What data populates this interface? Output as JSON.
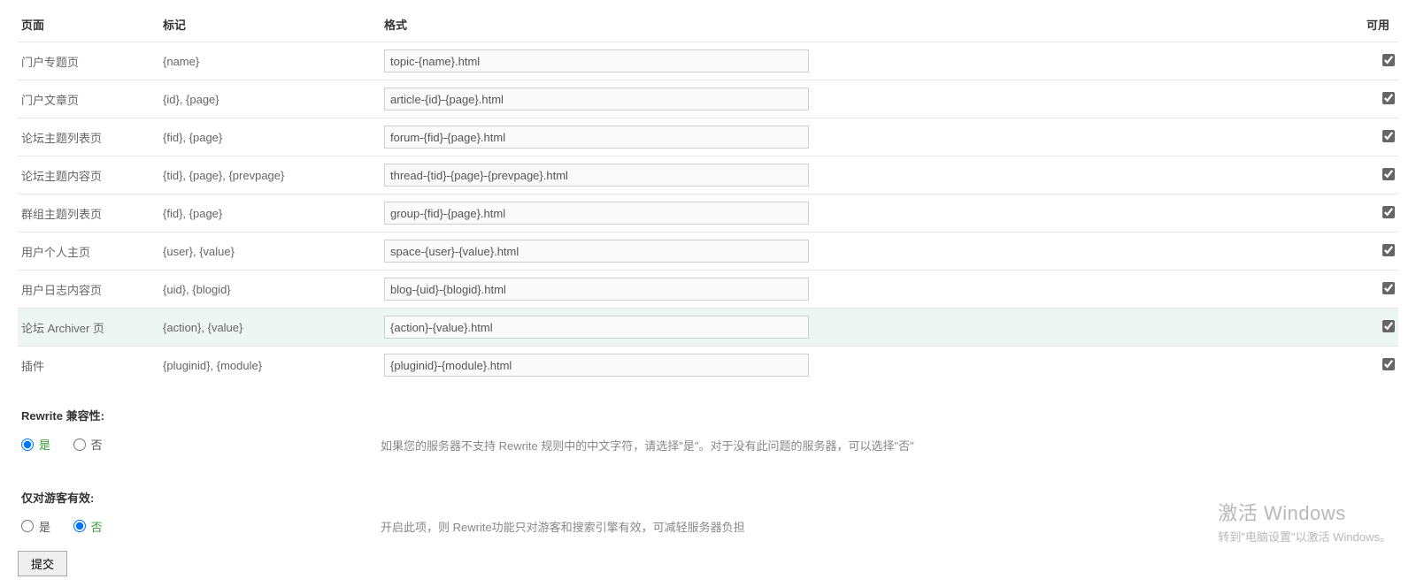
{
  "headers": {
    "page": "页面",
    "marker": "标记",
    "format": "格式",
    "avail": "可用"
  },
  "rows": [
    {
      "page": "门户专题页",
      "marker": "{name}",
      "format": "topic-{name}.html",
      "checked": true
    },
    {
      "page": "门户文章页",
      "marker": "{id}, {page}",
      "format": "article-{id}-{page}.html",
      "checked": true
    },
    {
      "page": "论坛主题列表页",
      "marker": "{fid}, {page}",
      "format": "forum-{fid}-{page}.html",
      "checked": true
    },
    {
      "page": "论坛主题内容页",
      "marker": "{tid}, {page}, {prevpage}",
      "format": "thread-{tid}-{page}-{prevpage}.html",
      "checked": true
    },
    {
      "page": "群组主题列表页",
      "marker": "{fid}, {page}",
      "format": "group-{fid}-{page}.html",
      "checked": true
    },
    {
      "page": "用户个人主页",
      "marker": "{user}, {value}",
      "format": "space-{user}-{value}.html",
      "checked": true
    },
    {
      "page": "用户日志内容页",
      "marker": "{uid}, {blogid}",
      "format": "blog-{uid}-{blogid}.html",
      "checked": true
    },
    {
      "page": "论坛 Archiver 页",
      "marker": "{action}, {value}",
      "format": "{action}-{value}.html",
      "checked": true,
      "hover": true
    },
    {
      "page": "插件",
      "marker": "{pluginid}, {module}",
      "format": "{pluginid}-{module}.html",
      "checked": true
    }
  ],
  "rewriteCompat": {
    "label": "Rewrite 兼容性:",
    "yes": "是",
    "no": "否",
    "selected": "yes",
    "help": "如果您的服务器不支持 Rewrite 规则中的中文字符，请选择\"是\"。对于没有此问题的服务器，可以选择\"否\""
  },
  "guestOnly": {
    "label": "仅对游客有效:",
    "yes": "是",
    "no": "否",
    "selected": "no",
    "help": "开启此项，则 Rewrite功能只对游客和搜索引擎有效，可减轻服务器负担"
  },
  "submit": "提交",
  "watermark": {
    "title": "激活 Windows",
    "sub": "转到\"电脑设置\"以激活 Windows。"
  }
}
